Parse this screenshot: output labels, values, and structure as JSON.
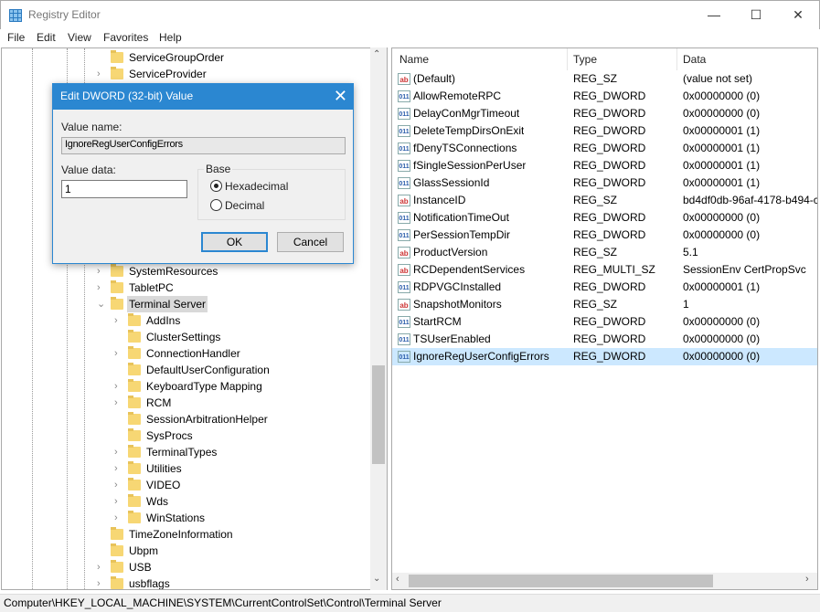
{
  "window": {
    "title": "Registry Editor",
    "minimize": "—",
    "maximize": "☐",
    "close": "✕"
  },
  "menu": [
    "File",
    "Edit",
    "View",
    "Favorites",
    "Help"
  ],
  "tree": {
    "items": [
      {
        "label": "ServiceGroupOrder",
        "level": 0,
        "expandable": false
      },
      {
        "label": "ServiceProvider",
        "level": 0,
        "expandable": true
      },
      {
        "label": "SystemResources",
        "level": 0,
        "expandable": true,
        "row": 13
      },
      {
        "label": "TabletPC",
        "level": 0,
        "expandable": true,
        "row": 14
      },
      {
        "label": "Terminal Server",
        "level": 0,
        "expandable": true,
        "expanded": true,
        "selected": true,
        "row": 15
      },
      {
        "label": "AddIns",
        "level": 1,
        "expandable": true,
        "row": 16
      },
      {
        "label": "ClusterSettings",
        "level": 1,
        "expandable": false,
        "row": 17
      },
      {
        "label": "ConnectionHandler",
        "level": 1,
        "expandable": true,
        "row": 18
      },
      {
        "label": "DefaultUserConfiguration",
        "level": 1,
        "expandable": false,
        "row": 19
      },
      {
        "label": "KeyboardType Mapping",
        "level": 1,
        "expandable": true,
        "row": 20
      },
      {
        "label": "RCM",
        "level": 1,
        "expandable": true,
        "row": 21
      },
      {
        "label": "SessionArbitrationHelper",
        "level": 1,
        "expandable": false,
        "row": 22
      },
      {
        "label": "SysProcs",
        "level": 1,
        "expandable": false,
        "row": 23
      },
      {
        "label": "TerminalTypes",
        "level": 1,
        "expandable": true,
        "row": 24
      },
      {
        "label": "Utilities",
        "level": 1,
        "expandable": true,
        "row": 25
      },
      {
        "label": "VIDEO",
        "level": 1,
        "expandable": true,
        "row": 26
      },
      {
        "label": "Wds",
        "level": 1,
        "expandable": true,
        "row": 27
      },
      {
        "label": "WinStations",
        "level": 1,
        "expandable": true,
        "row": 28
      },
      {
        "label": "TimeZoneInformation",
        "level": 0,
        "expandable": false,
        "row": 29
      },
      {
        "label": "Ubpm",
        "level": 0,
        "expandable": false,
        "row": 30
      },
      {
        "label": "USB",
        "level": 0,
        "expandable": true,
        "row": 31
      },
      {
        "label": "usbflags",
        "level": 0,
        "expandable": true,
        "row": 32
      }
    ]
  },
  "list": {
    "columns": [
      "Name",
      "Type",
      "Data"
    ],
    "rows": [
      {
        "icon": "string-value-icon",
        "name": "(Default)",
        "type": "REG_SZ",
        "data": "(value not set)"
      },
      {
        "icon": "binary-value-icon",
        "name": "AllowRemoteRPC",
        "type": "REG_DWORD",
        "data": "0x00000000 (0)"
      },
      {
        "icon": "binary-value-icon",
        "name": "DelayConMgrTimeout",
        "type": "REG_DWORD",
        "data": "0x00000000 (0)"
      },
      {
        "icon": "binary-value-icon",
        "name": "DeleteTempDirsOnExit",
        "type": "REG_DWORD",
        "data": "0x00000001 (1)"
      },
      {
        "icon": "binary-value-icon",
        "name": "fDenyTSConnections",
        "type": "REG_DWORD",
        "data": "0x00000001 (1)"
      },
      {
        "icon": "binary-value-icon",
        "name": "fSingleSessionPerUser",
        "type": "REG_DWORD",
        "data": "0x00000001 (1)"
      },
      {
        "icon": "binary-value-icon",
        "name": "GlassSessionId",
        "type": "REG_DWORD",
        "data": "0x00000001 (1)"
      },
      {
        "icon": "string-value-icon",
        "name": "InstanceID",
        "type": "REG_SZ",
        "data": "bd4df0db-96af-4178-b494-c"
      },
      {
        "icon": "binary-value-icon",
        "name": "NotificationTimeOut",
        "type": "REG_DWORD",
        "data": "0x00000000 (0)"
      },
      {
        "icon": "binary-value-icon",
        "name": "PerSessionTempDir",
        "type": "REG_DWORD",
        "data": "0x00000000 (0)"
      },
      {
        "icon": "string-value-icon",
        "name": "ProductVersion",
        "type": "REG_SZ",
        "data": "5.1"
      },
      {
        "icon": "string-value-icon",
        "name": "RCDependentServices",
        "type": "REG_MULTI_SZ",
        "data": "SessionEnv CertPropSvc"
      },
      {
        "icon": "binary-value-icon",
        "name": "RDPVGCInstalled",
        "type": "REG_DWORD",
        "data": "0x00000001 (1)"
      },
      {
        "icon": "string-value-icon",
        "name": "SnapshotMonitors",
        "type": "REG_SZ",
        "data": "1"
      },
      {
        "icon": "binary-value-icon",
        "name": "StartRCM",
        "type": "REG_DWORD",
        "data": "0x00000000 (0)"
      },
      {
        "icon": "binary-value-icon",
        "name": "TSUserEnabled",
        "type": "REG_DWORD",
        "data": "0x00000000 (0)"
      },
      {
        "icon": "binary-value-icon",
        "name": "IgnoreRegUserConfigErrors",
        "type": "REG_DWORD",
        "data": "0x00000000 (0)",
        "selected": true
      }
    ]
  },
  "status": "Computer\\HKEY_LOCAL_MACHINE\\SYSTEM\\CurrentControlSet\\Control\\Terminal Server",
  "dialog": {
    "title": "Edit DWORD (32-bit) Value",
    "close": "✕",
    "value_name_label": "Value name:",
    "value_name": "IgnoreRegUserConfigErrors",
    "value_data_label": "Value data:",
    "value_data": "1",
    "base_label": "Base",
    "base_options": [
      "Hexadecimal",
      "Decimal"
    ],
    "base_selected": "Hexadecimal",
    "ok": "OK",
    "cancel": "Cancel"
  },
  "colors": {
    "accent": "#2b87d1",
    "selection": "#cce8ff",
    "tree_selection": "#d9d9d9"
  }
}
